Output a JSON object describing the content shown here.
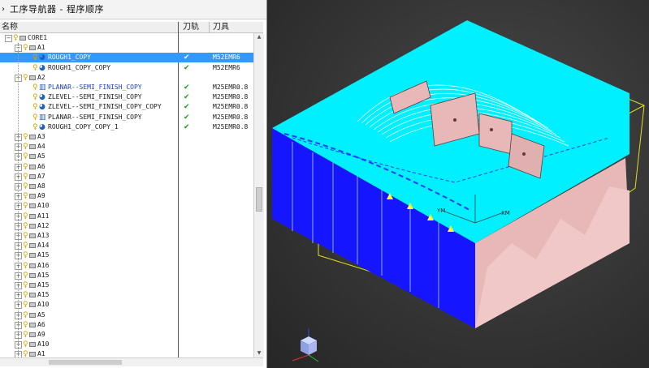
{
  "navigator": {
    "title": "工序导航器 - 程序顺序",
    "chevron": "›",
    "columns": {
      "name": "名称",
      "toolpath": "刀轨",
      "tool": "刀具"
    }
  },
  "tree": [
    {
      "depth": 0,
      "expander": "−",
      "kind": "group",
      "label": "CORE1"
    },
    {
      "depth": 1,
      "expander": "−",
      "kind": "group",
      "label": "A1"
    },
    {
      "depth": 2,
      "kind": "op",
      "label": "ROUGH1_COPY",
      "check": true,
      "tool": "M52EMR6",
      "selected": true
    },
    {
      "depth": 2,
      "kind": "op",
      "label": "ROUGH1_COPY_COPY",
      "check": true,
      "tool": "M52EMR6"
    },
    {
      "depth": 1,
      "expander": "−",
      "kind": "group",
      "label": "A2"
    },
    {
      "depth": 2,
      "kind": "planar",
      "label": "PLANAR--SEMI_FINISH_COPY",
      "check": true,
      "tool": "M25EMR0.8",
      "blue": true
    },
    {
      "depth": 2,
      "kind": "op",
      "label": "ZLEVEL--SEMI_FINISH_COPY",
      "check": true,
      "tool": "M25EMR0.8"
    },
    {
      "depth": 2,
      "kind": "op",
      "label": "ZLEVEL--SEMI_FINISH_COPY_COPY",
      "check": true,
      "tool": "M25EMR0.8"
    },
    {
      "depth": 2,
      "kind": "planar",
      "label": "PLANAR--SEMI_FINISH_COPY",
      "check": true,
      "tool": "M25EMR0.8"
    },
    {
      "depth": 2,
      "kind": "op",
      "label": "ROUGH1_COPY_COPY_1",
      "check": true,
      "tool": "M25EMR0.8"
    },
    {
      "depth": 1,
      "expander": "+",
      "kind": "group",
      "label": "A3"
    },
    {
      "depth": 1,
      "expander": "+",
      "kind": "group",
      "label": "A4"
    },
    {
      "depth": 1,
      "expander": "+",
      "kind": "group",
      "label": "A5"
    },
    {
      "depth": 1,
      "expander": "+",
      "kind": "group",
      "label": "A6"
    },
    {
      "depth": 1,
      "expander": "+",
      "kind": "group",
      "label": "A7"
    },
    {
      "depth": 1,
      "expander": "+",
      "kind": "group",
      "label": "A8"
    },
    {
      "depth": 1,
      "expander": "+",
      "kind": "group",
      "label": "A9"
    },
    {
      "depth": 1,
      "expander": "+",
      "kind": "group",
      "label": "A10"
    },
    {
      "depth": 1,
      "expander": "+",
      "kind": "group",
      "label": "A11"
    },
    {
      "depth": 1,
      "expander": "+",
      "kind": "group",
      "label": "A12"
    },
    {
      "depth": 1,
      "expander": "+",
      "kind": "group",
      "label": "A13"
    },
    {
      "depth": 1,
      "expander": "+",
      "kind": "group",
      "label": "A14"
    },
    {
      "depth": 1,
      "expander": "+",
      "kind": "group",
      "label": "A15"
    },
    {
      "depth": 1,
      "expander": "+",
      "kind": "group",
      "label": "A16"
    },
    {
      "depth": 1,
      "expander": "+",
      "kind": "group",
      "label": "A15"
    },
    {
      "depth": 1,
      "expander": "+",
      "kind": "group",
      "label": "A15"
    },
    {
      "depth": 1,
      "expander": "+",
      "kind": "group",
      "label": "A15"
    },
    {
      "depth": 1,
      "expander": "+",
      "kind": "group",
      "label": "A10"
    },
    {
      "depth": 1,
      "expander": "+",
      "kind": "group",
      "label": "A5"
    },
    {
      "depth": 1,
      "expander": "+",
      "kind": "group",
      "label": "A6"
    },
    {
      "depth": 1,
      "expander": "+",
      "kind": "group",
      "label": "A9"
    },
    {
      "depth": 1,
      "expander": "+",
      "kind": "group",
      "label": "A10"
    },
    {
      "depth": 1,
      "expander": "+",
      "kind": "group",
      "label": "A1"
    }
  ],
  "viewport": {
    "axis_labels": {
      "xm": "XM",
      "ym": "YM"
    },
    "colors": {
      "stock_top": "#00ffff",
      "side": "#1515ff",
      "part": "#e8b8b8",
      "dark": "#5a3a3a",
      "boundary": "#e0e020",
      "background": "#333333"
    }
  },
  "icons": {
    "check": "check-icon",
    "expander": "tree-expander-icon",
    "key": "key-icon",
    "folder": "folder-icon",
    "operation": "operation-icon"
  }
}
